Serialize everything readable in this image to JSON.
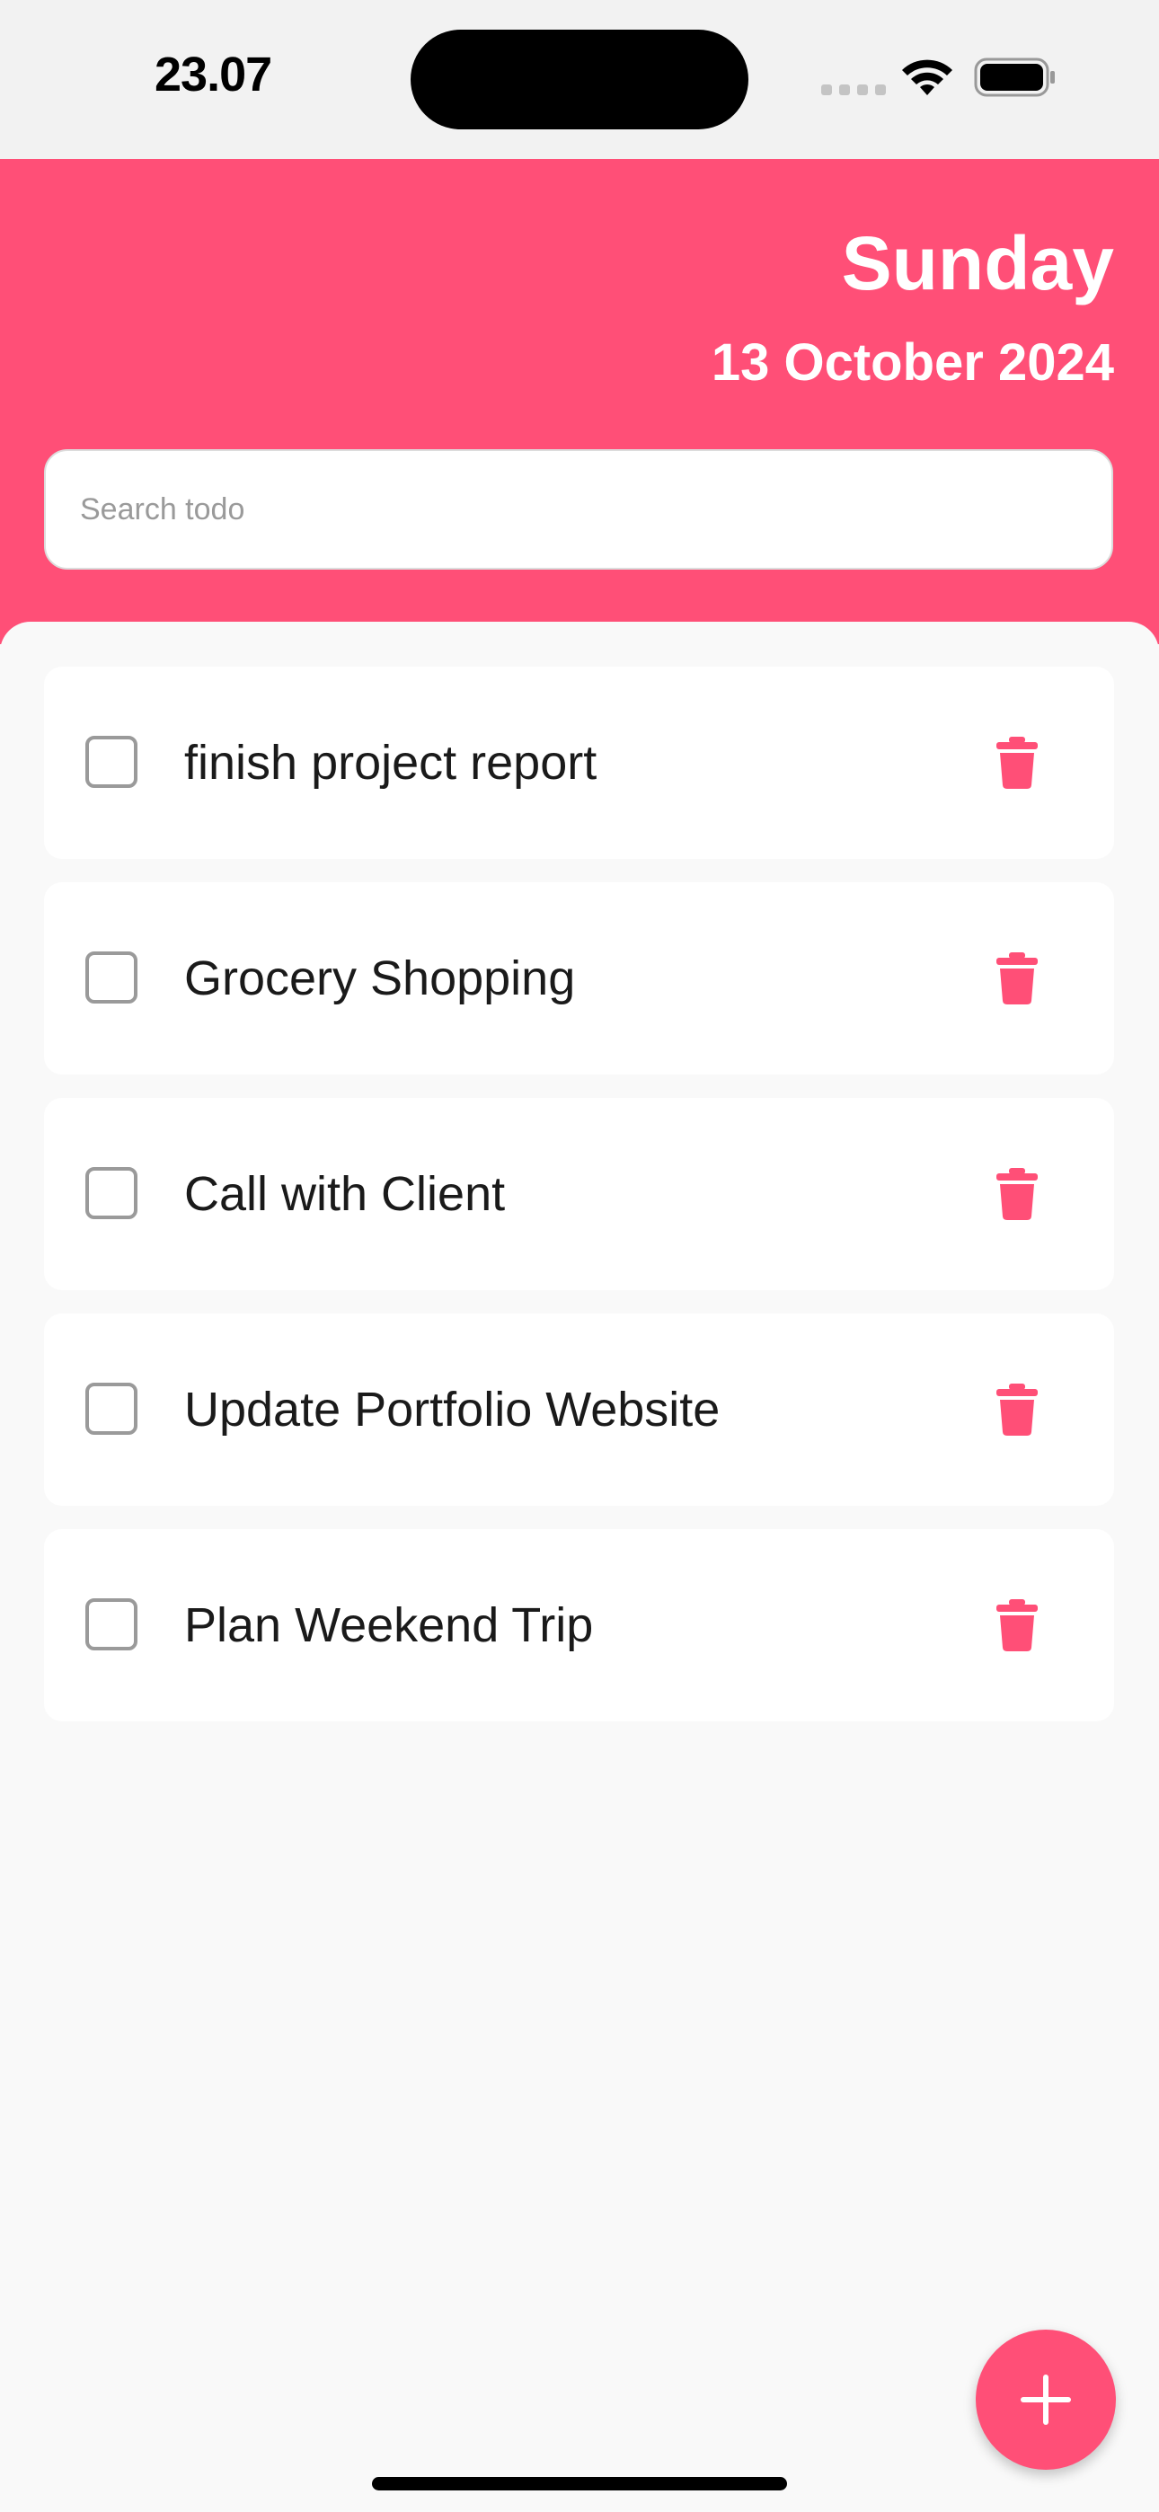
{
  "status_bar": {
    "time": "23.07"
  },
  "header": {
    "day": "Sunday",
    "date": "13 October 2024",
    "background_color": "#ff4f77"
  },
  "search": {
    "placeholder": "Search todo",
    "value": ""
  },
  "todos": [
    {
      "text": "finish project report",
      "done": false
    },
    {
      "text": "Grocery Shopping",
      "done": false
    },
    {
      "text": "Call with Client",
      "done": false
    },
    {
      "text": "Update Portfolio Website",
      "done": false
    },
    {
      "text": "Plan Weekend Trip",
      "done": false
    }
  ],
  "icons": {
    "delete": "trash-icon",
    "add": "plus-icon",
    "wifi": "wifi-icon",
    "battery": "battery-icon"
  },
  "colors": {
    "accent": "#ff4f77",
    "checkbox_border": "#9a9a9a",
    "background": "#f9f9f9"
  }
}
